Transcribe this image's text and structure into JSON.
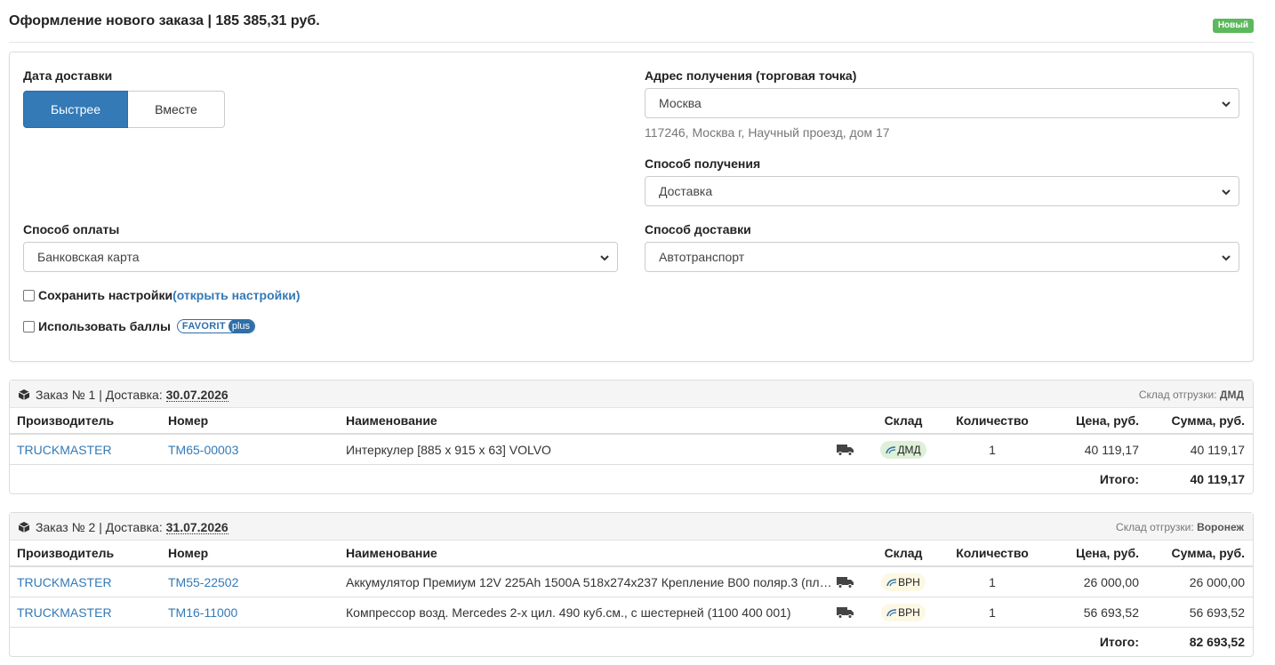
{
  "header": {
    "title": "Оформление нового заказа | 185 385,31 руб.",
    "status_badge": "Новый"
  },
  "form": {
    "delivery_date_label": "Дата доставки",
    "delivery_date_options": [
      "Быстрее",
      "Вместе"
    ],
    "delivery_date_selected": "Быстрее",
    "address_label": "Адрес получения (торговая точка)",
    "address_value": "Москва",
    "address_detail": "117246, Москва г, Научный проезд, дом 17",
    "receive_method_label": "Способ получения",
    "receive_method_value": "Доставка",
    "payment_label": "Способ оплаты",
    "payment_value": "Банковская карта",
    "delivery_method_label": "Способ доставки",
    "delivery_method_value": "Автотранспорт",
    "save_settings_label": "Сохранить настройки",
    "open_settings_link": "(открыть настройки)",
    "use_points_label": "Использовать баллы",
    "favorit_logo": [
      "FAVORIT",
      "plus"
    ]
  },
  "table_headers": {
    "manufacturer": "Производитель",
    "number": "Номер",
    "name": "Наименование",
    "warehouse": "Склад",
    "quantity": "Количество",
    "price": "Цена, руб.",
    "sum": "Сумма, руб."
  },
  "total_label": "Итого:",
  "ship_from_label": "Склад отгрузки:",
  "orders": [
    {
      "title_prefix": "Заказ № 1 | Доставка:",
      "date": "30.07.2026",
      "ship_from": "ДМД",
      "items": [
        {
          "manufacturer": "TRUCKMASTER",
          "number": "TM65-00003",
          "name": "Интеркулер [885 x 915 x 63] VOLVO",
          "warehouse": "ДМД",
          "warehouse_color": "#dff0d8",
          "quantity": "1",
          "price": "40 119,17",
          "sum": "40 119,17"
        }
      ],
      "total": "40 119,17"
    },
    {
      "title_prefix": "Заказ № 2 | Доставка:",
      "date": "31.07.2026",
      "ship_from": "Воронеж",
      "items": [
        {
          "manufacturer": "TRUCKMASTER",
          "number": "TM55-22502",
          "name": "Аккумулятор Премиум 12V 225Ah 1500A 518x274x237 Крепление B00 поляр.3 (пл…",
          "warehouse": "ВРН",
          "warehouse_color": "#fcf8e3",
          "quantity": "1",
          "price": "26 000,00",
          "sum": "26 000,00"
        },
        {
          "manufacturer": "TRUCKMASTER",
          "number": "TM16-11000",
          "name": "Компрессор возд. Mercedes 2-х цил. 490 куб.см., с шестерней (1100 400 001)",
          "warehouse": "ВРН",
          "warehouse_color": "#fcf8e3",
          "quantity": "1",
          "price": "56 693,52",
          "sum": "56 693,52"
        }
      ],
      "total": "82 693,52"
    }
  ],
  "colors": {
    "accent": "#337ab7",
    "badge_green": "#5cb85c",
    "warehouse_dmd": "#dff0d8",
    "warehouse_vrn": "#fcf8e3"
  },
  "icons": [
    "box-icon",
    "truck-icon",
    "chevron-down-icon",
    "warehouse-logo-icon"
  ]
}
